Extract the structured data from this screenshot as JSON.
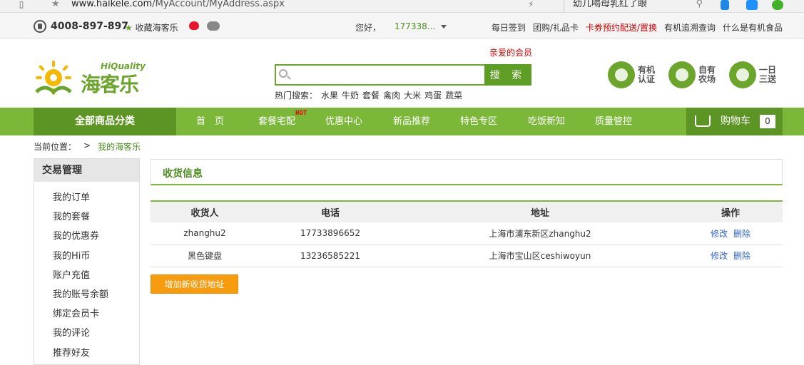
{
  "browser": {
    "url_host": "www.haikele.com",
    "url_path": "/MyAccount/MyAddress.aspx",
    "side_search_text": "幼儿喝母乳红了眼"
  },
  "topbar": {
    "phone": "4008-897-897",
    "favorite": "收藏海客乐",
    "greeting": "您好，",
    "username": "177338...",
    "links": [
      "每日签到",
      "团购/礼品卡",
      "卡券预约配送/置换",
      "有机追溯查询",
      "什么是有机食品"
    ]
  },
  "header": {
    "brand": "海客乐",
    "brand_en": "HiQuality",
    "promo_text": "亲爱的会员",
    "search_placeholder": "",
    "search_button": "搜 索",
    "hot_label": "热门搜索：",
    "hot_keywords": [
      "水果",
      "牛奶",
      "套餐",
      "禽肉",
      "大米",
      "鸡蛋",
      "蔬菜"
    ],
    "badges": [
      {
        "label_line1": "有机",
        "label_line2": "认证",
        "icon": "organic-cert-icon"
      },
      {
        "label_line1": "自有",
        "label_line2": "农场",
        "icon": "recycle-farm-icon"
      },
      {
        "label_line1": "一日",
        "label_line2": "三送",
        "icon": "delivery-truck-icon"
      }
    ]
  },
  "nav": {
    "all_categories": "全部商品分类",
    "items": [
      "首　页",
      "套餐宅配",
      "优惠中心",
      "新品推荐",
      "特色专区",
      "吃饭新知",
      "质量管控"
    ],
    "hot_tag": "HOT",
    "cart_label": "购物车",
    "cart_count": "0"
  },
  "breadcrumb": {
    "label": "当前位置：",
    "separator": ">",
    "current": "我的海客乐"
  },
  "sidebar": {
    "title": "交易管理",
    "items": [
      "我的订单",
      "我的套餐",
      "我的优惠券",
      "我的Hi币",
      "账户充值",
      "我的账号余额",
      "绑定会员卡",
      "我的评论",
      "推荐好友"
    ]
  },
  "main": {
    "panel_title": "收货信息",
    "columns": [
      "收货人",
      "电话",
      "地址",
      "操作"
    ],
    "rows": [
      {
        "name": "zhanghu2",
        "phone": "17733896652",
        "address": "上海市浦东新区zhanghu2",
        "edit": "修改",
        "delete": "删除"
      },
      {
        "name": "黑色键盘",
        "phone": "13236585221",
        "address": "上海市宝山区ceshiwoyun",
        "edit": "修改",
        "delete": "删除"
      }
    ],
    "add_button": "增加新收货地址"
  },
  "colors": {
    "brand_green": "#7bb83a",
    "dark_green": "#5c9524",
    "accent_orange": "#f79b0f",
    "link_blue": "#3366cc",
    "alert_red": "#d30000"
  }
}
